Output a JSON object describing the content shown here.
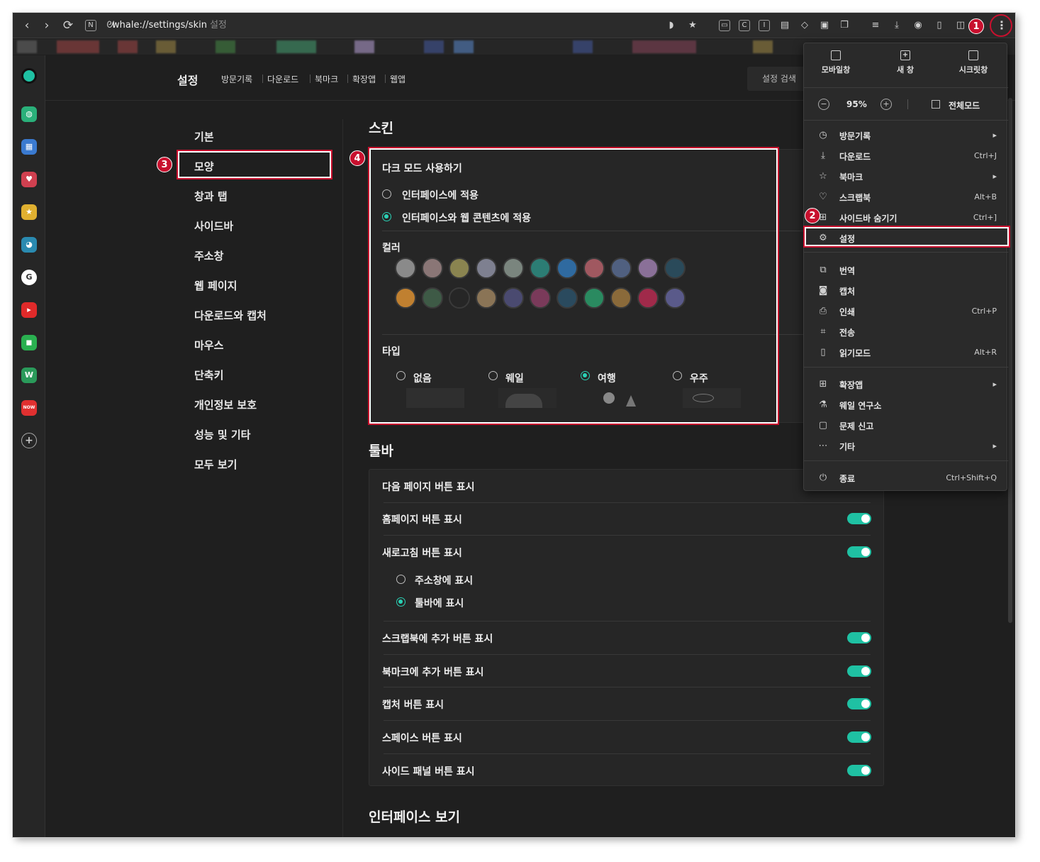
{
  "address_bar": {
    "url": "whale://settings/skin",
    "page_hint": "설정"
  },
  "top_nav": {
    "title": "설정",
    "links": [
      "방문기록",
      "다운로드",
      "북마크",
      "확장앱",
      "웹앱"
    ],
    "search_label": "설정 검색"
  },
  "left_nav": {
    "items": [
      "기본",
      "모양",
      "창과 탭",
      "사이드바",
      "주소창",
      "웹 페이지",
      "다운로드와 캡처",
      "마우스",
      "단축키",
      "개인정보 보호",
      "성능 및 기타",
      "모두 보기"
    ],
    "selected": "모양"
  },
  "skin": {
    "title": "스킨",
    "dark_mode_label": "다크 모드 사용하기",
    "options": [
      {
        "label": "인터페이스에 적용",
        "selected": false
      },
      {
        "label": "인터페이스와 웹 콘텐츠에 적용",
        "selected": true
      }
    ],
    "color_label": "컬러",
    "colors_row1": [
      "#8a8a8a",
      "#8a7676",
      "#8a8450",
      "#7e8090",
      "#7a857e",
      "#2c7d74",
      "#2f6aa0",
      "#a05860",
      "#506080",
      "#8a7098",
      "#2a4a5a"
    ],
    "colors_row2": [
      "#c08030",
      "#3e5a46",
      "#262626",
      "#8a7456",
      "#4a4a70",
      "#7a3a5a",
      "#2a4a5e",
      "#2a8a60",
      "#8a6a3a",
      "#a02a4a",
      "#5a5a8a"
    ],
    "type_label": "타입",
    "types": [
      {
        "label": "없음",
        "selected": false
      },
      {
        "label": "웨일",
        "selected": false
      },
      {
        "label": "여행",
        "selected": true
      },
      {
        "label": "우주",
        "selected": false
      }
    ]
  },
  "toolbar": {
    "title": "툴바",
    "rows": [
      {
        "label": "다음 페이지 버튼 표시",
        "toggle": null
      },
      {
        "label": "홈페이지 버튼 표시",
        "toggle": true
      },
      {
        "label": "새로고침 버튼 표시",
        "toggle": true
      },
      {
        "label": "스크랩북에 추가 버튼 표시",
        "toggle": true
      },
      {
        "label": "북마크에 추가 버튼 표시",
        "toggle": true
      },
      {
        "label": "캡처 버튼 표시",
        "toggle": true
      },
      {
        "label": "스페이스 버튼 표시",
        "toggle": true
      },
      {
        "label": "사이드 패널 버튼 표시",
        "toggle": true
      }
    ],
    "refresh_options": [
      {
        "label": "주소창에 표시",
        "selected": false
      },
      {
        "label": "툴바에 표시",
        "selected": true
      }
    ]
  },
  "interface_section": {
    "title": "인터페이스 보기"
  },
  "menu": {
    "quick": [
      "모바일창",
      "새 창",
      "시크릿창"
    ],
    "zoom": "95%",
    "fullscreen": "전체모드",
    "group1": [
      {
        "label": "방문기록",
        "shortcut": "▸",
        "icon": "clock-icon"
      },
      {
        "label": "다운로드",
        "shortcut": "Ctrl+J",
        "icon": "download-icon"
      },
      {
        "label": "북마크",
        "shortcut": "▸",
        "icon": "star-icon"
      },
      {
        "label": "스크랩북",
        "shortcut": "Alt+B",
        "icon": "scrapbook-icon"
      },
      {
        "label": "사이드바 숨기기",
        "shortcut": "Ctrl+]",
        "icon": "sidebar-icon"
      },
      {
        "label": "설정",
        "shortcut": "",
        "icon": "gear-icon"
      }
    ],
    "group2": [
      {
        "label": "번역",
        "shortcut": "",
        "icon": "translate-icon"
      },
      {
        "label": "캡처",
        "shortcut": "",
        "icon": "camera-icon"
      },
      {
        "label": "인쇄",
        "shortcut": "Ctrl+P",
        "icon": "print-icon"
      },
      {
        "label": "전송",
        "shortcut": "",
        "icon": "cast-icon"
      },
      {
        "label": "읽기모드",
        "shortcut": "Alt+R",
        "icon": "book-icon"
      }
    ],
    "group3": [
      {
        "label": "확장앱",
        "shortcut": "▸",
        "icon": "grid-icon"
      },
      {
        "label": "웨일 연구소",
        "shortcut": "",
        "icon": "flask-icon"
      },
      {
        "label": "문제 신고",
        "shortcut": "",
        "icon": "report-icon"
      },
      {
        "label": "기타",
        "shortcut": "▸",
        "icon": "more-icon"
      }
    ],
    "exit": {
      "label": "종료",
      "shortcut": "Ctrl+Shift+Q",
      "icon": "power-icon"
    }
  },
  "badges": [
    "1",
    "2",
    "3",
    "4"
  ],
  "accent_color": "#1fc1a3",
  "highlight_color": "#c8102e"
}
